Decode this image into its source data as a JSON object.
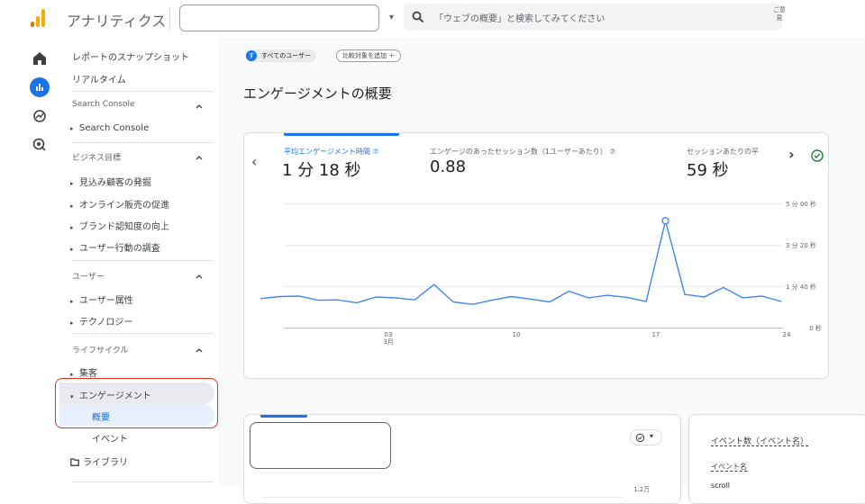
{
  "header": {
    "app_title": "アナリティクス",
    "search_placeholder": "「ウェブの概要」と検索してみてください",
    "search_extra": "ご意見",
    "account_value": "",
    "logo_colors": [
      "#e37400",
      "#f9ab00",
      "#f9ab00"
    ]
  },
  "rail": {
    "icons": [
      "home-icon",
      "reports-icon",
      "explore-icon",
      "advertising-icon"
    ],
    "active_color": "#1a73e8"
  },
  "nav": {
    "snapshot": "レポートのスナップショット",
    "realtime": "リアルタイム",
    "search_console_section": "Search Console",
    "search_console_item": "Search Console",
    "business_section": "ビジネス目標",
    "business_items": [
      "見込み顧客の発掘",
      "オンライン販売の促進",
      "ブランド認知度の向上",
      "ユーザー行動の調査"
    ],
    "user_section": "ユーザー",
    "user_items": [
      "ユーザー属性",
      "テクノロジー"
    ],
    "lifecycle_section": "ライフサイクル",
    "acquisition": "集客",
    "engagement": "エンゲージメント",
    "overview": "概要",
    "events": "イベント",
    "library": "ライブラリ"
  },
  "main": {
    "chip_user_icon": "す",
    "chip_user_label": "すべてのユーザー",
    "chip_add_label": "比較対象を追加 ＋",
    "page_title": "エンゲージメントの概要",
    "metrics": [
      {
        "label": "平均エンゲージメント時間 ⑦",
        "value": "1 分 18 秒"
      },
      {
        "label": "エンゲージのあったセッション数（1ユーザーあたり） ⑦",
        "value": "0.88"
      },
      {
        "label": "セッションあたりの平",
        "value": "59 秒"
      }
    ],
    "y_ticks": [
      "5 分 00 秒",
      "3 分 20 秒",
      "1 分 40 秒",
      "0 秒"
    ],
    "x_ticks": [
      {
        "l1": "03",
        "l2": "3月"
      },
      {
        "l1": "10",
        "l2": ""
      },
      {
        "l1": "17",
        "l2": ""
      },
      {
        "l1": "24",
        "l2": ""
      }
    ],
    "card3_title": "イベント数（イベント名）",
    "card3_col": "イベント名",
    "card3_row1": "scroll",
    "card2_tick": "1.2万"
  },
  "chart_data": {
    "type": "line",
    "title": "",
    "xlabel": "",
    "ylabel": "",
    "x_start": "2月26日",
    "x_end": "3月24日",
    "values_seconds": [
      70,
      75,
      76,
      66,
      67,
      60,
      74,
      72,
      67,
      104,
      62,
      56,
      66,
      75,
      69,
      62,
      88,
      72,
      78,
      73,
      63,
      258,
      80,
      74,
      97,
      72,
      76,
      63
    ],
    "ylim_seconds": [
      0,
      300
    ],
    "highlight_index": 21,
    "color": "#4285f4"
  }
}
